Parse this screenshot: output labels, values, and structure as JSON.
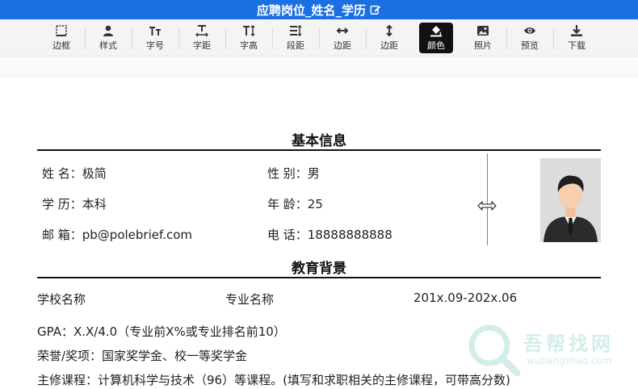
{
  "header": {
    "title": "应聘岗位_姓名_学历"
  },
  "toolbar": {
    "items": [
      {
        "label": "边框",
        "icon": "border-icon"
      },
      {
        "label": "样式",
        "icon": "person-icon"
      },
      {
        "label": "字号",
        "icon": "font-size-icon"
      },
      {
        "label": "字距",
        "icon": "letter-spacing-icon"
      },
      {
        "label": "字高",
        "icon": "font-height-icon"
      },
      {
        "label": "段距",
        "icon": "paragraph-spacing-icon"
      },
      {
        "label": "边距",
        "icon": "horizontal-margin-icon"
      },
      {
        "label": "边距",
        "icon": "vertical-margin-icon"
      },
      {
        "label": "颜色",
        "icon": "paint-bucket-icon",
        "active": true
      },
      {
        "label": "照片",
        "icon": "image-icon"
      },
      {
        "label": "预览",
        "icon": "eye-icon"
      },
      {
        "label": "下载",
        "icon": "download-icon"
      }
    ]
  },
  "basic_info": {
    "title": "基本信息",
    "name": "姓 名：极简",
    "gender": "性 别：男",
    "education": "学 历：本科",
    "age": "年 龄：25",
    "email": "邮 箱：pb@polebrief.com",
    "phone": "电 话：18888888888"
  },
  "education_bg": {
    "title": "教育背景",
    "school": "学校名称",
    "major": "专业名称",
    "period": "201x.09-202x.06",
    "gpa": "GPA：X.X/4.0（专业前X%或专业排名前10）",
    "honors": "荣誉/奖项：国家奖学金、校一等奖学金",
    "courses": "主修课程：计算机科学与技术（96）等课程。(填写和求职相关的主修课程，可带高分数)"
  },
  "watermark": {
    "text": "吾帮找网",
    "url": "wubangzhao.com"
  },
  "colors": {
    "header_bg": "#1a6fe3",
    "active_tool_bg": "#111111",
    "guide_line": "#2aa6c4"
  }
}
